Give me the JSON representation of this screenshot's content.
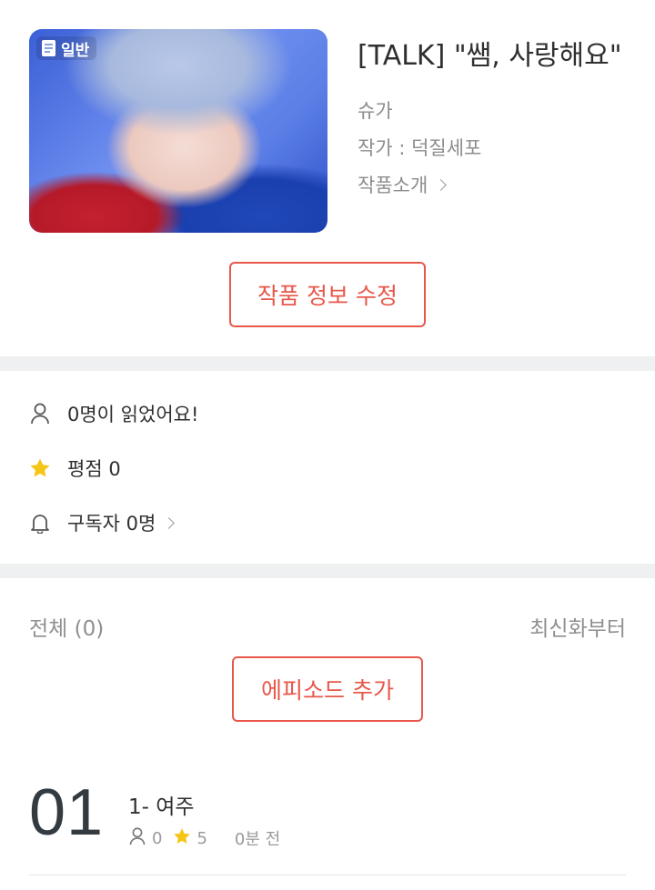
{
  "work": {
    "badge": "일반",
    "title": "[TALK] \"쌤, 사랑해요\"",
    "genre": "슈가",
    "author": "작가 : 덕질세포",
    "intro_link": "작품소개"
  },
  "edit_button": "작품 정보 수정",
  "stats": {
    "readers": "0명이 읽었어요!",
    "rating": "평점 0",
    "subscribers": "구독자 0명"
  },
  "episodes_header": {
    "total": "전체 (0)",
    "sort": "최신화부터"
  },
  "add_episode_button": "에피소드 추가",
  "episodes": [
    {
      "number": "01",
      "title": "1- 여주",
      "views": "0",
      "rating": "5",
      "time": "0분 전"
    }
  ],
  "colors": {
    "accent": "#e8574a",
    "star": "#f5c518",
    "divider": "#eef0f2"
  },
  "icons": {
    "badge": "document-icon",
    "readers": "person-icon",
    "rating": "star-icon",
    "subscribers": "bell-icon",
    "more": "chevron-right-icon"
  }
}
